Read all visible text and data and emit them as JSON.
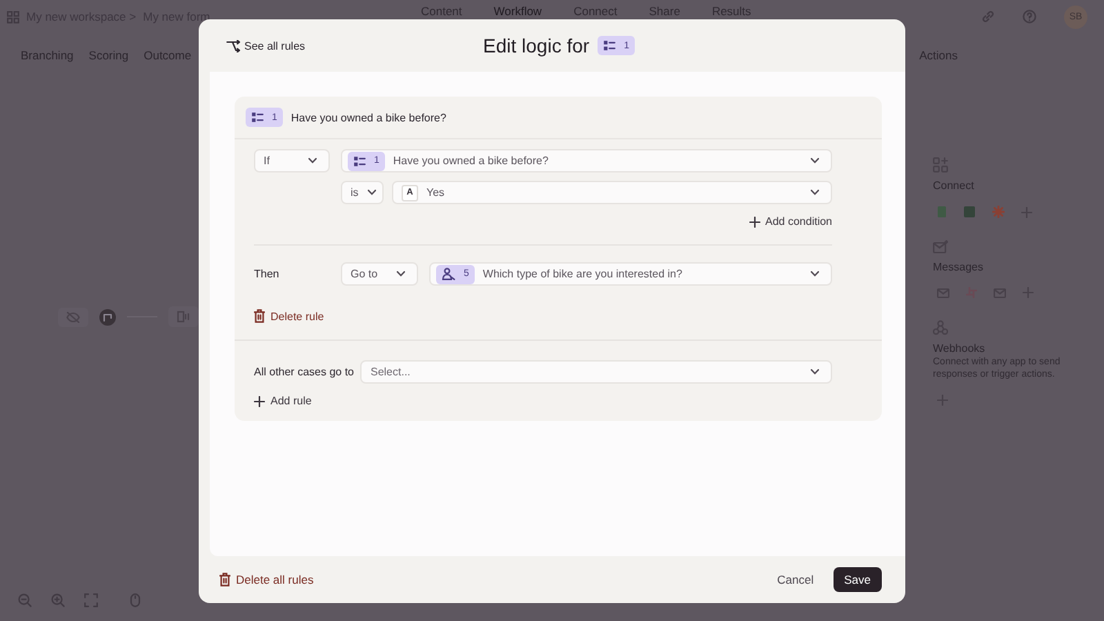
{
  "topbar": {
    "breadcrumb": [
      "My new workspace >",
      "My new form"
    ],
    "nav": [
      {
        "label": "Content",
        "selected": false
      },
      {
        "label": "Workflow",
        "selected": true
      },
      {
        "label": "Connect",
        "selected": false
      },
      {
        "label": "Share",
        "selected": false
      },
      {
        "label": "Results",
        "selected": false
      }
    ],
    "avatar": "SB"
  },
  "subtabs": [
    {
      "label": "Branching"
    },
    {
      "label": "Scoring"
    },
    {
      "label": "Outcome"
    }
  ],
  "panel_title": "Actions",
  "sections": [
    {
      "kind": "connect",
      "title": "Connect"
    },
    {
      "kind": "messages",
      "title": "Messages"
    },
    {
      "kind": "webhooks",
      "title": "Webhooks",
      "description": "Connect with any app to send responses or trigger actions."
    }
  ],
  "modal": {
    "see_all": "See all rules",
    "title": "Edit logic for",
    "title_question": {
      "kind": "multiple_choice",
      "number": "1"
    },
    "rule": {
      "question": {
        "kind": "multiple_choice",
        "number": "1",
        "text": "Have you owned a bike before?"
      },
      "condition": {
        "operator": "If",
        "question": {
          "kind": "multiple_choice",
          "number": "1",
          "text": "Have you owned a bike before?"
        },
        "comparator": "is",
        "answer_letter": "A",
        "answer": "Yes"
      },
      "add_condition": "Add condition",
      "then_label": "Then",
      "action": "Go to",
      "target": {
        "kind": "picture_choice",
        "number": "5",
        "text": "Which type of bike are you interested in?"
      },
      "delete_rule": "Delete rule"
    },
    "fallback": {
      "label": "All other cases go to",
      "placeholder": "Select..."
    },
    "add_rule": "Add rule",
    "footer": {
      "delete_all": "Delete all rules",
      "cancel": "Cancel",
      "save": "Save"
    }
  }
}
